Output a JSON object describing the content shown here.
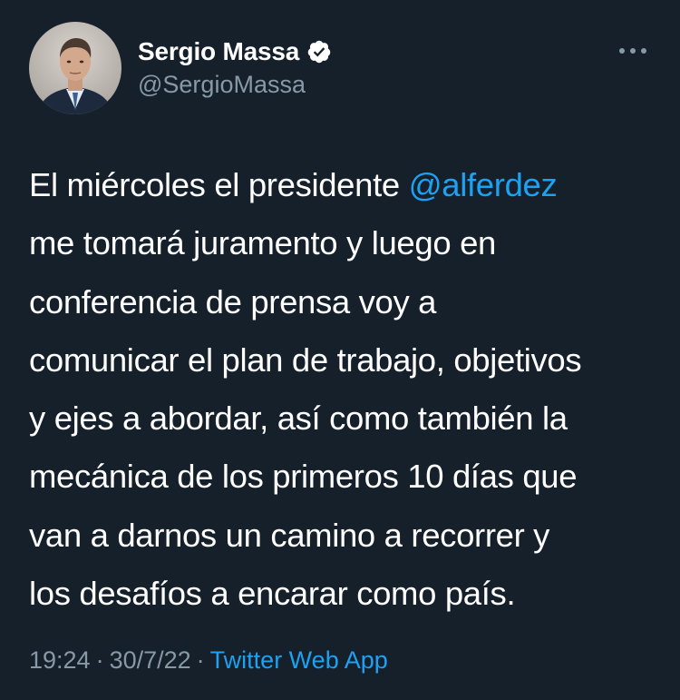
{
  "author": {
    "display_name": "Sergio Massa",
    "handle": "@SergioMassa",
    "verified": true,
    "avatar_icon": "profile-photo"
  },
  "more_icon": "more-horizontal-icon",
  "tweet": {
    "lines": [
      {
        "before": "El miércoles el presidente ",
        "mention": "@alferdez",
        "after": ""
      },
      {
        "before": "me tomará juramento y luego en",
        "mention": "",
        "after": ""
      },
      {
        "before": "conferencia de prensa voy a",
        "mention": "",
        "after": ""
      },
      {
        "before": "comunicar el plan de trabajo, objetivos",
        "mention": "",
        "after": ""
      },
      {
        "before": "y ejes a abordar, así como también la",
        "mention": "",
        "after": ""
      },
      {
        "before": "mecánica de los primeros 10 días que",
        "mention": "",
        "after": ""
      },
      {
        "before": "van a darnos un camino a recorrer y",
        "mention": "",
        "after": ""
      },
      {
        "before": "los desafíos a encarar como país.",
        "mention": "",
        "after": ""
      }
    ]
  },
  "meta": {
    "time": "19:24",
    "separator": "·",
    "date": "30/7/22",
    "source": "Twitter Web App"
  },
  "colors": {
    "background": "#15202b",
    "text": "#ffffff",
    "secondary": "#8899a6",
    "accent": "#1da1f2"
  }
}
